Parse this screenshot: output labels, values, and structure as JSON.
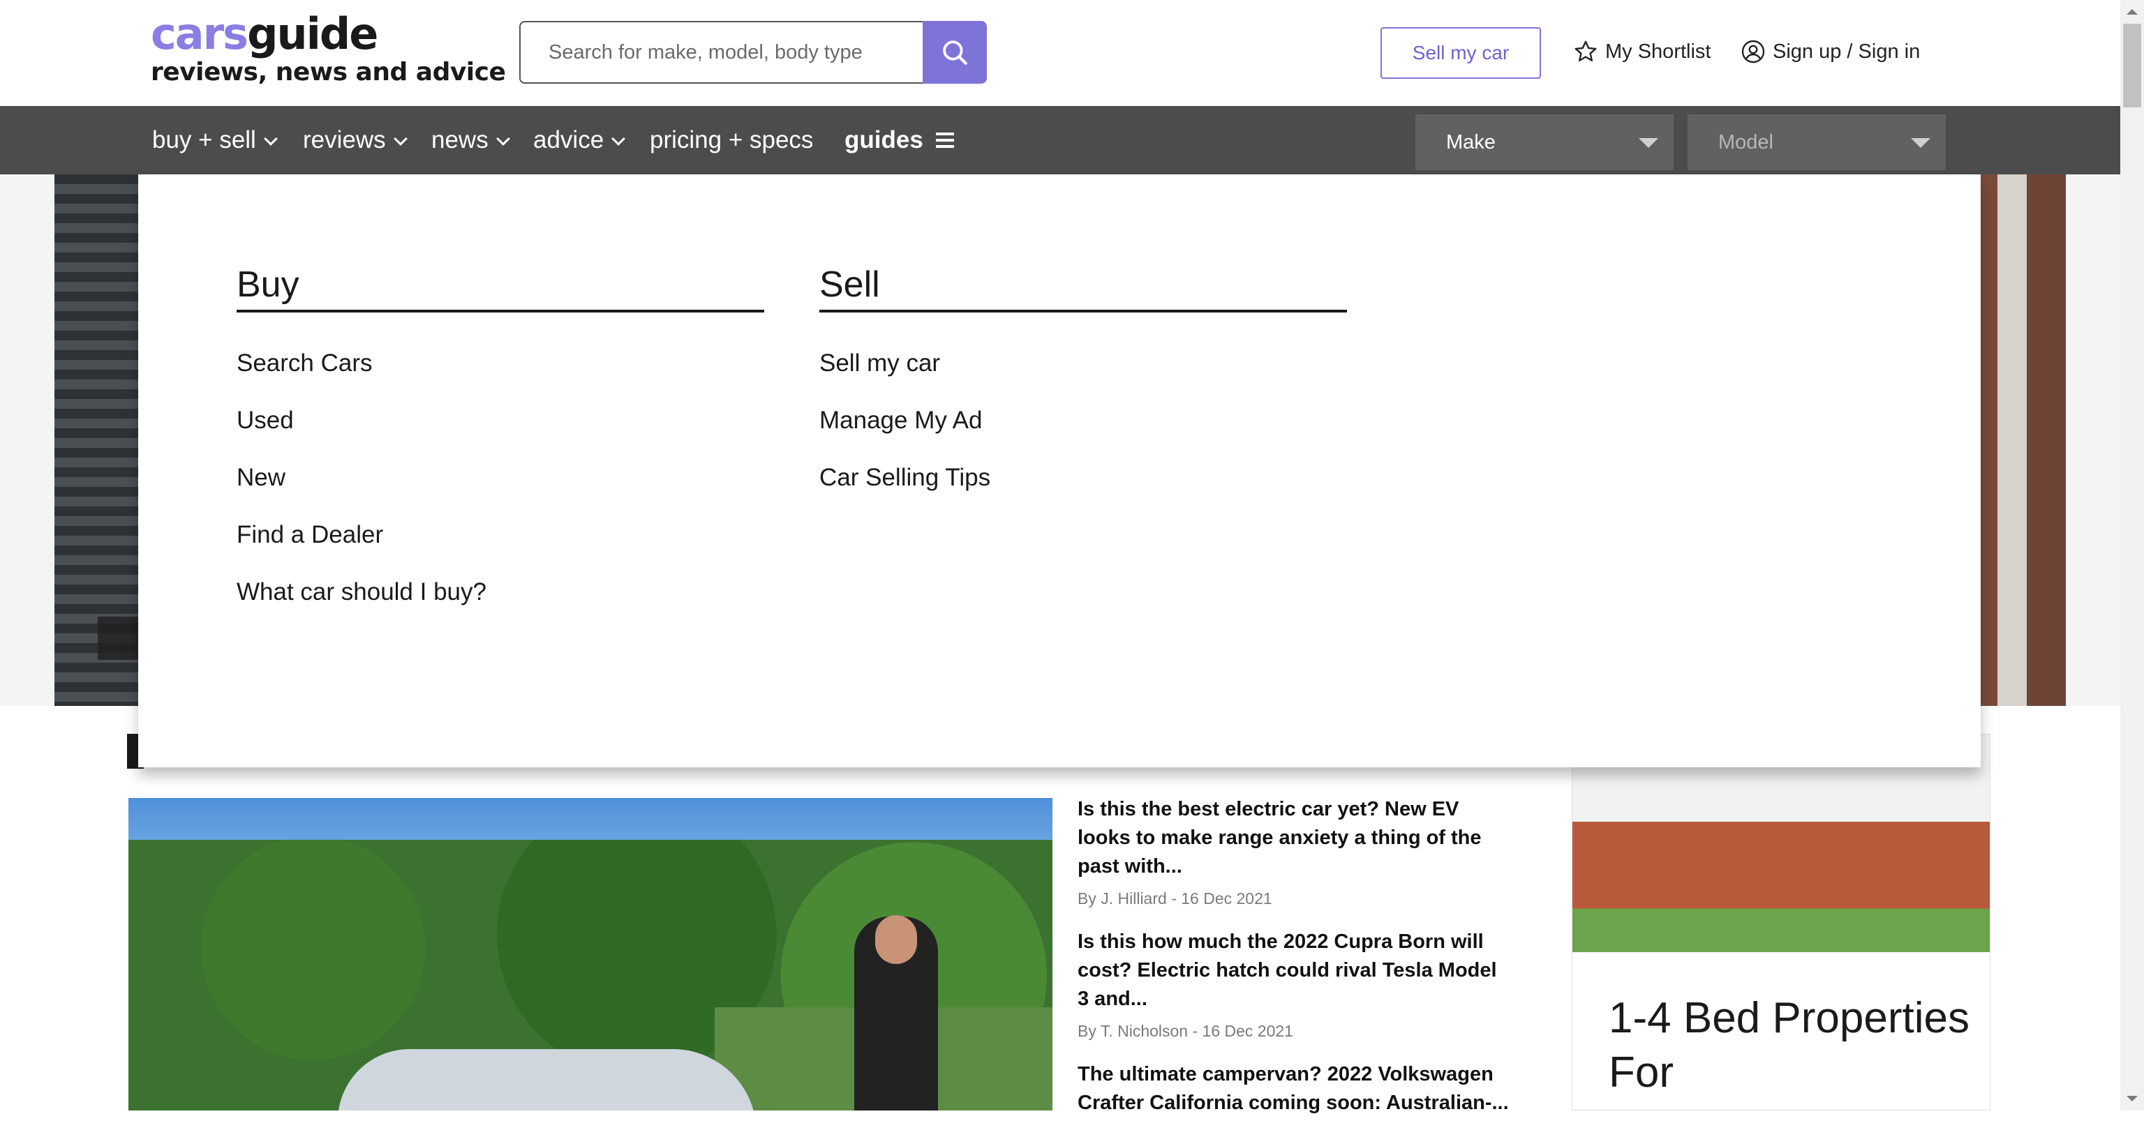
{
  "brand": {
    "logo_part1": "cars",
    "logo_part2": "guide",
    "tagline": "reviews, news and advice",
    "accent_color": "#7f73d8"
  },
  "header": {
    "search_placeholder": "Search for make, model, body type",
    "search_icon": "search-icon",
    "sell_label": "Sell my car",
    "shortlist_label": "My Shortlist",
    "shortlist_icon": "star-icon",
    "signin_label": "Sign up / Sign in",
    "signin_icon": "user-circle-icon"
  },
  "nav": {
    "items": [
      {
        "label": "buy + sell"
      },
      {
        "label": "reviews"
      },
      {
        "label": "news"
      },
      {
        "label": "advice"
      },
      {
        "label": "pricing + specs"
      },
      {
        "label": "guides"
      }
    ],
    "make_label": "Make",
    "model_label": "Model"
  },
  "mega_menu": {
    "buy": {
      "title": "Buy",
      "items": [
        "Search Cars",
        "Used",
        "New",
        "Find a Dealer",
        "What car should I buy?"
      ]
    },
    "sell": {
      "title": "Sell",
      "items": [
        "Sell my car",
        "Manage My Ad",
        "Car Selling Tips"
      ]
    }
  },
  "articles": [
    {
      "title": "Is this the best electric car yet? New EV looks to make range anxiety a thing of the past with...",
      "meta": "By J. Hilliard - 16 Dec 2021"
    },
    {
      "title": "Is this how much the 2022 Cupra Born will cost? Electric hatch could rival Tesla Model 3 and...",
      "meta": "By T. Nicholson - 16 Dec 2021"
    },
    {
      "title": "The ultimate campervan? 2022 Volkswagen Crafter California coming soon: Australian-...",
      "meta": ""
    }
  ],
  "ad": {
    "headline": "1-4 Bed Properties For"
  }
}
